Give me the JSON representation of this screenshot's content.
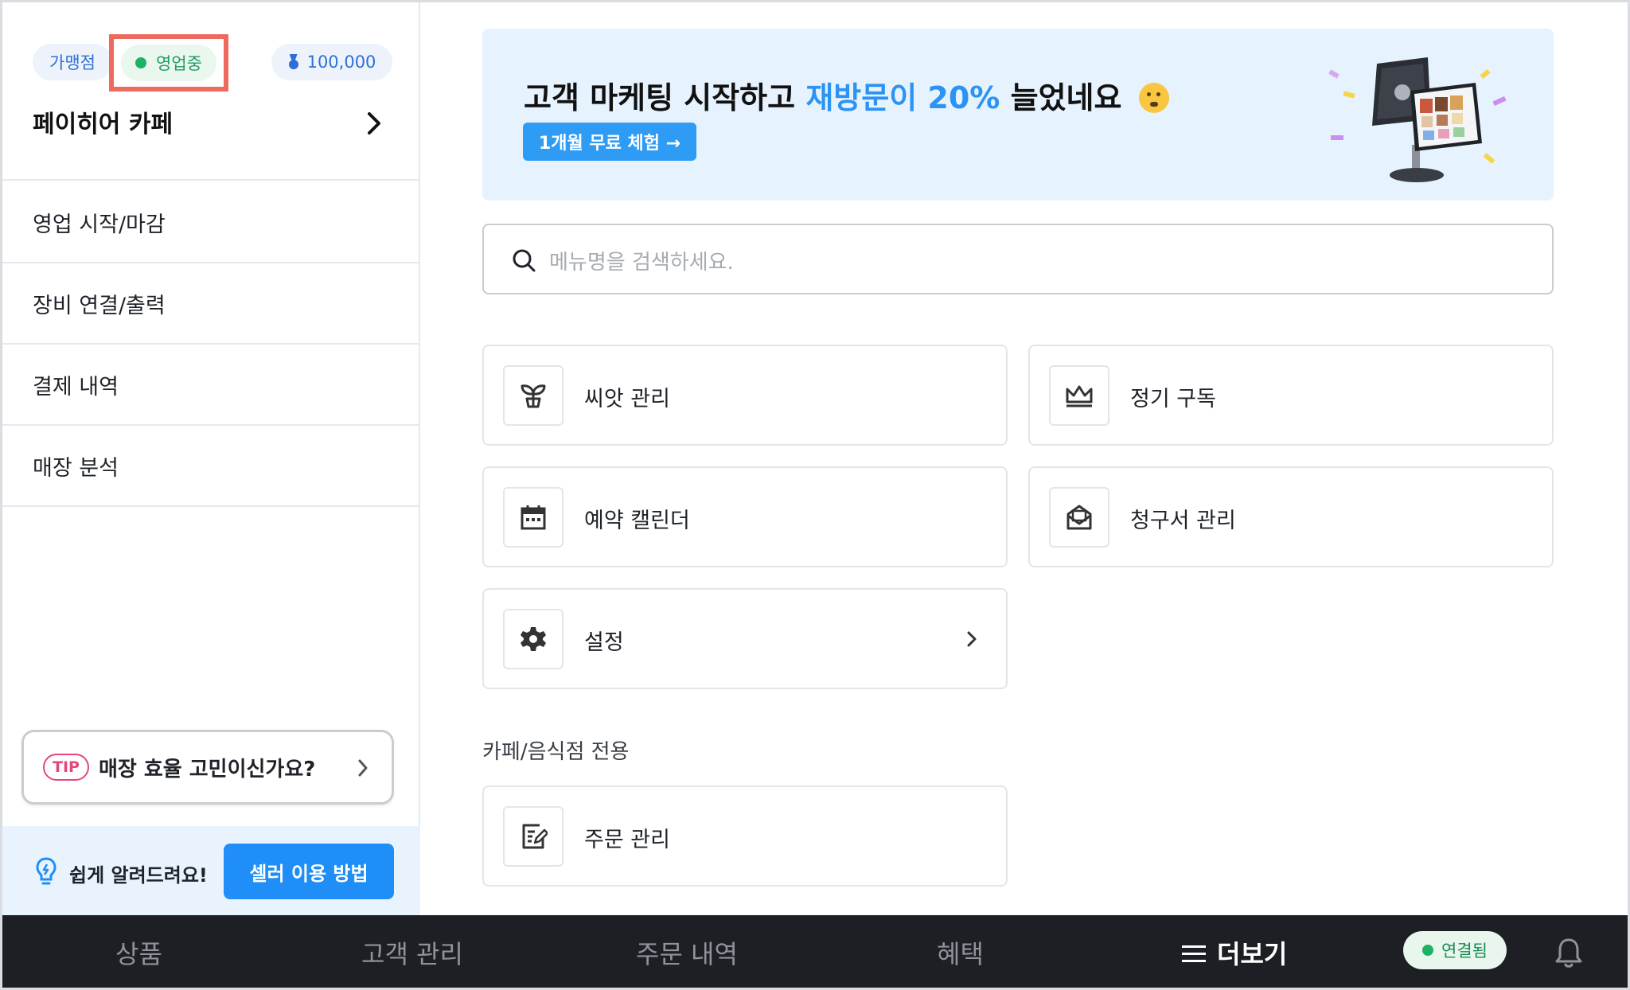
{
  "sidebar": {
    "franchise_chip": "가맹점",
    "status_chip": "영업중",
    "points_chip": "100,000",
    "store_name": "페이히어 카페",
    "items": [
      {
        "label": "영업 시작/마감"
      },
      {
        "label": "장비 연결/출력"
      },
      {
        "label": "결제 내역"
      },
      {
        "label": "매장 분석"
      }
    ],
    "tip": {
      "badge": "TIP",
      "text": "매장 효율 고민이신가요?"
    },
    "help": {
      "text": "쉽게 알려드려요!",
      "button": "셀러 이용 방법"
    }
  },
  "banner": {
    "title_prefix": "고객 마케팅 시작하고",
    "title_highlight": "재방문이 20%",
    "title_suffix": "늘었네요",
    "button": "1개월 무료 체험 →"
  },
  "search": {
    "placeholder": "메뉴명을 검색하세요."
  },
  "cards": [
    {
      "label": "씨앗 관리",
      "icon": "sprout-icon"
    },
    {
      "label": "정기 구독",
      "icon": "crown-icon"
    },
    {
      "label": "예약 캘린더",
      "icon": "calendar-icon"
    },
    {
      "label": "청구서 관리",
      "icon": "invoice-mail-icon"
    },
    {
      "label": "설정",
      "icon": "gear-icon"
    }
  ],
  "cafe_section": {
    "title": "카페/음식점 전용",
    "cards": [
      {
        "label": "주문 관리",
        "icon": "order-edit-icon"
      }
    ]
  },
  "bottom_nav": {
    "items": [
      "상품",
      "고객 관리",
      "주문 내역",
      "혜택"
    ],
    "active": "더보기",
    "connection": "연결됨"
  },
  "colors": {
    "accent": "#1f8ef6",
    "highlight": "#2a93f3",
    "status_green": "#1db364",
    "tip_pink": "#e4467e",
    "nav_bg": "#1d1f24"
  }
}
